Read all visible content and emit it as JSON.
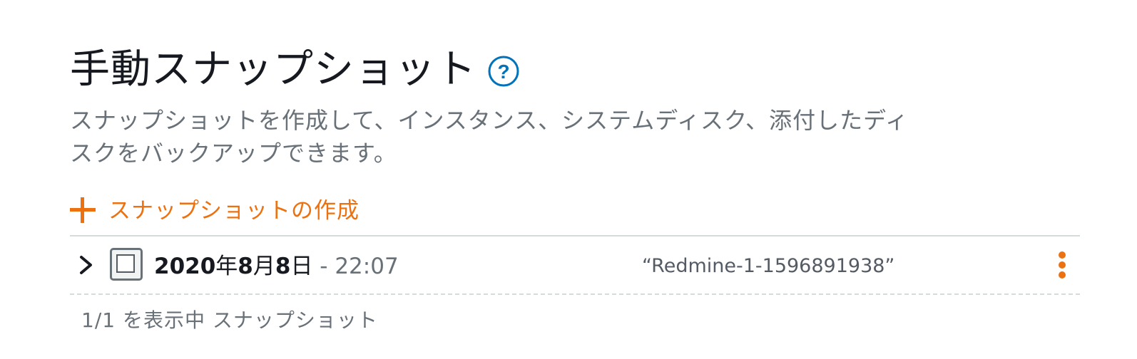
{
  "header": {
    "title": "手動スナップショット",
    "help_icon": "help-circle-icon"
  },
  "description": "スナップショットを作成して、インスタンス、システムディスク、添付したディスクをバックアップできます。",
  "create_action": {
    "label": "スナップショットの作成",
    "icon": "plus-icon"
  },
  "snapshots": [
    {
      "date_parts": {
        "year": "2020",
        "year_unit": "年",
        "month": "8",
        "month_unit": "月",
        "day": "8",
        "day_unit": "日"
      },
      "time": " - 22:07",
      "name": "“Redmine-1-1596891938”",
      "expand_icon": "chevron-right-icon",
      "menu_icon": "vertical-ellipsis-icon"
    }
  ],
  "footer": {
    "count_text": "1/1 を表示中 スナップショット"
  },
  "colors": {
    "accent": "#ec7211",
    "help": "#0073bb",
    "text_primary": "#16191f",
    "text_secondary": "#687078",
    "divider": "#d5dbdb"
  }
}
